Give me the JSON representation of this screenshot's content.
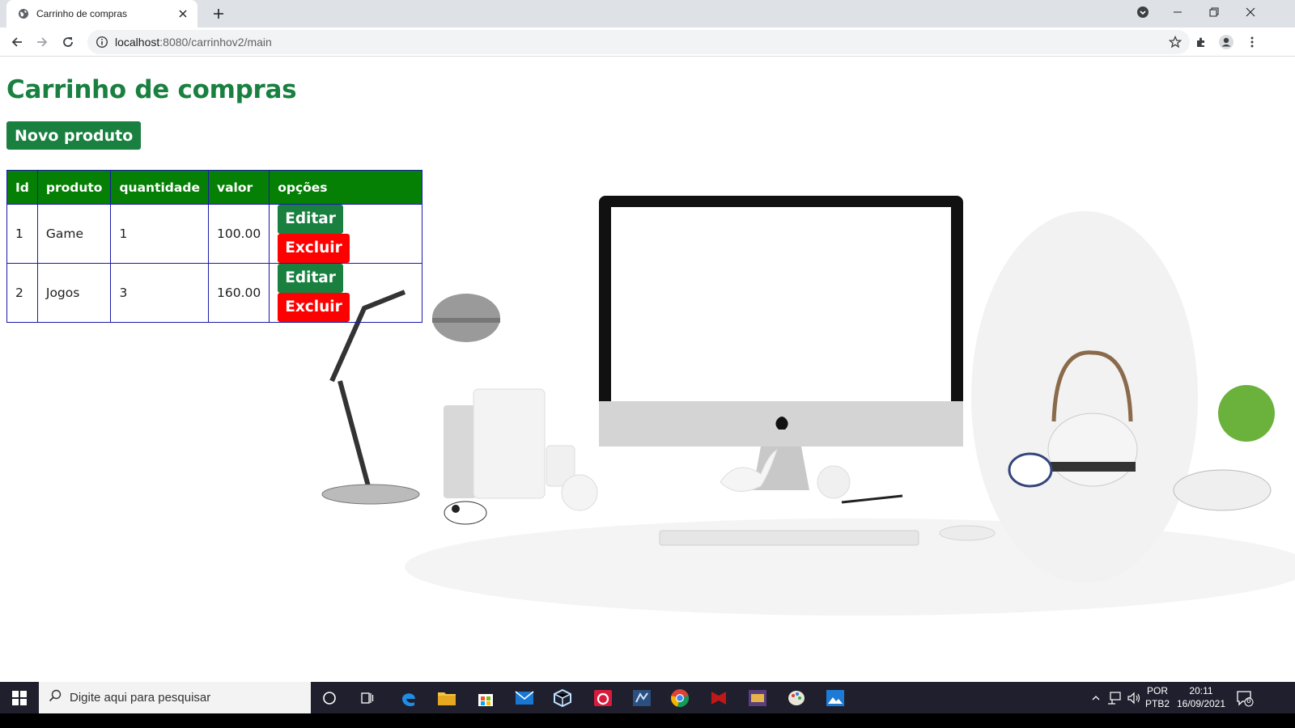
{
  "browser": {
    "tab_title": "Carrinho de compras",
    "url_host": "localhost",
    "url_path": ":8080/carrinhov2/main"
  },
  "page": {
    "title": "Carrinho de compras",
    "new_product_label": "Novo produto",
    "table": {
      "headers": [
        "Id",
        "produto",
        "quantidade",
        "valor",
        "opções"
      ],
      "rows": [
        {
          "id": "1",
          "produto": "Game",
          "quantidade": "1",
          "valor": "100.00"
        },
        {
          "id": "2",
          "produto": "Jogos",
          "quantidade": "3",
          "valor": "160.00"
        }
      ],
      "edit_label": "Editar",
      "delete_label": "Excluir"
    }
  },
  "colors": {
    "primary_green": "#198040",
    "header_green": "#058005",
    "delete_red": "#ff0000",
    "table_border": "#1a1aa8"
  },
  "taskbar": {
    "search_placeholder": "Digite aqui para pesquisar",
    "lang_top": "POR",
    "lang_bottom": "PTB2",
    "time": "20:11",
    "date": "16/09/2021",
    "notification_count": "6",
    "icons": [
      "windows-start-icon",
      "cortana-icon",
      "task-view-icon",
      "edge-icon",
      "file-explorer-icon",
      "store-icon",
      "mail-icon",
      "virtualbox-icon",
      "app-icon",
      "dev-tool-icon",
      "chrome-icon",
      "mcafee-icon",
      "game-icon",
      "paint-icon",
      "photos-icon"
    ]
  }
}
